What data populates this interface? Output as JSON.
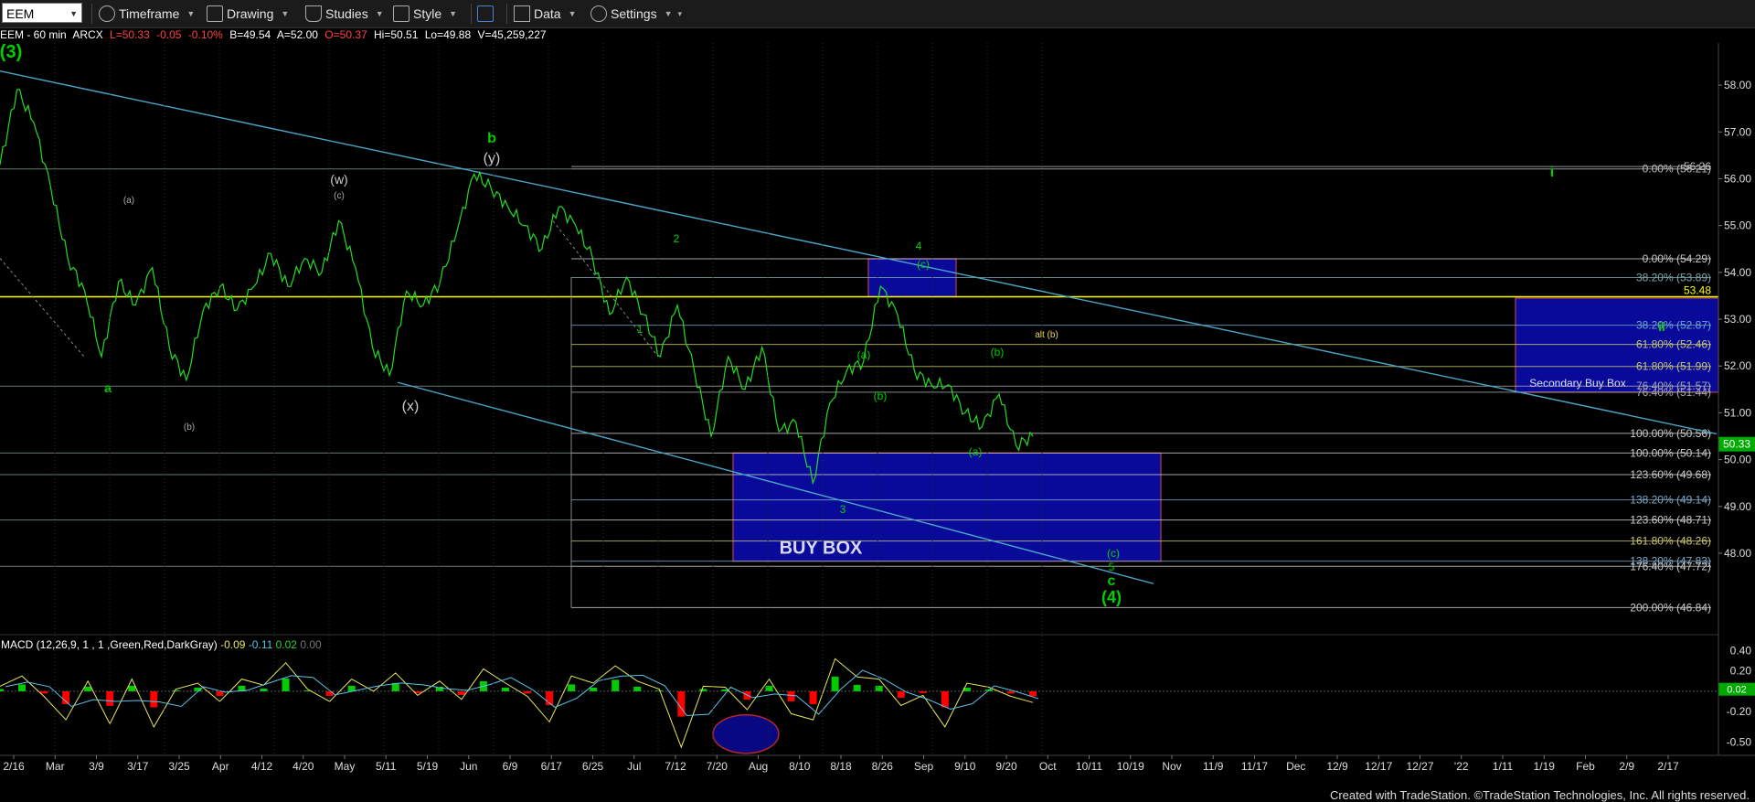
{
  "toolbar": {
    "symbol": "EEM",
    "timeframe_label": "Timeframe",
    "drawing_label": "Drawing",
    "studies_label": "Studies",
    "style_label": "Style",
    "data_label": "Data",
    "settings_label": "Settings"
  },
  "status": {
    "symbol": "EEM - 60 min",
    "exchange": "ARCX",
    "last": "L=50.33",
    "change": "-0.05",
    "pct": "-0.10%",
    "bid": "B=49.54",
    "ask": "A=52.00",
    "open": "O=50.37",
    "high": "Hi=50.51",
    "low": "Lo=49.88",
    "volume": "V=45,259,227"
  },
  "macd": {
    "label": "MACD (12,26,9, 1 , 1 ,Green,Red,DarkGray)",
    "v1": "-0.09",
    "v2": "-0.11",
    "v3": "0.02",
    "v4": "0.00",
    "last_label": "0.02"
  },
  "footer": "Created with TradeStation. ©TradeStation Technologies, Inc. All rights reserved.",
  "chart_data": {
    "type": "line",
    "title": "EEM - 60 min",
    "price_axis_ticks": [
      "58.00",
      "57.00",
      "56.00",
      "55.00",
      "54.00",
      "53.00",
      "52.00",
      "51.00",
      "50.00",
      "49.00",
      "48.00"
    ],
    "price_range": [
      46.3,
      58.9
    ],
    "price_tick_values": [
      58,
      57,
      56,
      55,
      54,
      53,
      52,
      51,
      50,
      49,
      48
    ],
    "macd_axis_ticks": [
      "0.40",
      "0.20",
      "-0.20",
      "-0.50"
    ],
    "macd_tick_values": [
      0.4,
      0.2,
      -0.2,
      -0.5
    ],
    "macd_range": [
      -0.62,
      0.52
    ],
    "x_axis_labels": [
      "2/16",
      "Mar",
      "3/9",
      "3/17",
      "3/25",
      "Apr",
      "4/12",
      "4/20",
      "May",
      "5/11",
      "5/19",
      "Jun",
      "6/9",
      "6/17",
      "6/25",
      "Jul",
      "7/12",
      "7/20",
      "Aug",
      "8/10",
      "8/18",
      "8/26",
      "Sep",
      "9/10",
      "9/20",
      "Oct",
      "10/11",
      "10/19",
      "Nov",
      "11/9",
      "11/17",
      "Dec",
      "12/9",
      "12/17",
      "12/27",
      "'22",
      "1/11",
      "1/19",
      "Feb",
      "2/9",
      "2/17"
    ],
    "last_price": "50.33",
    "price_series": [
      56.3,
      57.9,
      57.2,
      55.8,
      54.3,
      53.6,
      52.2,
      53.8,
      53.3,
      54.1,
      52.4,
      51.7,
      53.2,
      53.7,
      53.2,
      53.7,
      54.4,
      53.7,
      54.3,
      54.0,
      55.1,
      54.1,
      52.4,
      51.8,
      53.6,
      53.3,
      53.8,
      54.9,
      56.1,
      55.8,
      55.4,
      55.0,
      54.5,
      55.4,
      55.0,
      54.3,
      53.1,
      53.9,
      53.1,
      52.2,
      53.3,
      51.9,
      50.5,
      52.2,
      51.5,
      52.4,
      50.6,
      50.8,
      49.5,
      51.2,
      51.9,
      52.1,
      53.7,
      53.1,
      51.9,
      51.6,
      51.6,
      51.0,
      50.7,
      51.4,
      50.3,
      50.5
    ],
    "macd_series": [
      0.05,
      0.15,
      -0.05,
      -0.28,
      0.1,
      -0.32,
      0.12,
      -0.35,
      0.02,
      0.08,
      -0.1,
      0.12,
      0.06,
      0.28,
      0.02,
      -0.1,
      0.12,
      0.0,
      0.18,
      -0.04,
      0.1,
      -0.08,
      0.22,
      0.08,
      -0.05,
      -0.3,
      0.15,
      0.08,
      0.25,
      0.1,
      0.02,
      -0.55,
      0.05,
      0.04,
      -0.18,
      0.12,
      -0.22,
      -0.28,
      0.32,
      0.14,
      0.12,
      -0.14,
      -0.04,
      -0.35,
      0.08,
      0.04,
      -0.05,
      -0.11
    ],
    "wave_labels": {
      "w3_big": "(3)",
      "wa": "a",
      "wsa": "(a)",
      "wsb": "(b)",
      "ww": "(w)",
      "wc_small": "(c)",
      "wb": "b",
      "wy": "(y)",
      "wx": "(x)",
      "w1": "1",
      "w2": "2",
      "w3": "3",
      "w4": "4",
      "wc4": "(c)",
      "wma": "(a)",
      "wmb": "(b)",
      "wna": "(a)",
      "wnb": "(b)",
      "walt": "alt (b)",
      "wlc": "(c)",
      "w5": "5",
      "wc": "c",
      "w4big": "(4)",
      "wi": "i",
      "wii": "ii"
    },
    "fib_labels": [
      {
        "text": "0.00% (56.21)",
        "price": 56.21,
        "color": "#bbbbbb"
      },
      {
        "text": "56.26",
        "price": 56.26,
        "color": "#bbbbbb"
      },
      {
        "text": "0.00% (54.29)",
        "price": 54.29,
        "color": "#cccccc"
      },
      {
        "text": "38.20% (53.89)",
        "price": 53.89,
        "color": "#7fa8a8"
      },
      {
        "text": "38.20% (52.87)",
        "price": 52.87,
        "color": "#6fa8c8"
      },
      {
        "text": "61.80% (52.46)",
        "price": 52.46,
        "color": "#c8c870"
      },
      {
        "text": "61.80% (51.99)",
        "price": 51.99,
        "color": "#c8c870"
      },
      {
        "text": "76.40% (51.57)",
        "price": 51.57,
        "color": "#aaaaaa"
      },
      {
        "text": "76.40% (51.44)",
        "price": 51.44,
        "color": "#aaaaaa"
      },
      {
        "text": "100.00% (50.56)",
        "price": 50.56,
        "color": "#cccccc"
      },
      {
        "text": "100.00% (50.14)",
        "price": 50.14,
        "color": "#cccccc"
      },
      {
        "text": "123.60% (49.68)",
        "price": 49.68,
        "color": "#cccccc"
      },
      {
        "text": "138.20% (49.14)",
        "price": 49.14,
        "color": "#7fa8c8"
      },
      {
        "text": "123.60% (48.71)",
        "price": 48.71,
        "color": "#cccccc"
      },
      {
        "text": "161.80% (48.26)",
        "price": 48.26,
        "color": "#c8c870"
      },
      {
        "text": "138.20% (47.83)",
        "price": 47.83,
        "color": "#7fa8c8"
      },
      {
        "text": "176.40% (47.72)",
        "price": 47.72,
        "color": "#cccccc"
      },
      {
        "text": "200.00% (46.84)",
        "price": 46.84,
        "color": "#cccccc"
      }
    ],
    "key_level": {
      "price": 53.48,
      "label": "53.48",
      "color": "#ffff00"
    },
    "buy_box": {
      "label": "BUY BOX",
      "top": 50.14,
      "bottom": 47.83
    },
    "secondary_box": {
      "label": "Secondary Buy Box",
      "top": 53.45,
      "bottom": 51.44
    },
    "wave4_box": {
      "top": 54.29,
      "bottom": 53.48
    },
    "colors": {
      "up": "#00cc00",
      "down": "#ff0000",
      "price": "#22dd22",
      "trend": "#4aa6c8",
      "box": "#0a0a9a"
    }
  }
}
